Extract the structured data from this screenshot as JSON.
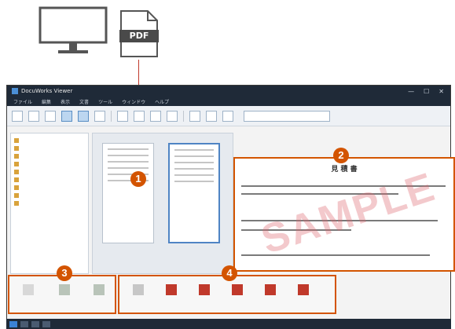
{
  "pdf_label": "PDF",
  "window_title": "DocuWorks Viewer",
  "menu": [
    "ファイル",
    "編集",
    "表示",
    "文書",
    "ツール",
    "ウィンドウ",
    "ヘルプ"
  ],
  "preview": {
    "title": "見 積 書",
    "watermark": "SAMPLE"
  },
  "badges": [
    "1",
    "2",
    "3",
    "4"
  ],
  "colors": {
    "accent": "#d35400",
    "titlebar": "#1f2a38",
    "selection": "#4f84c4"
  }
}
